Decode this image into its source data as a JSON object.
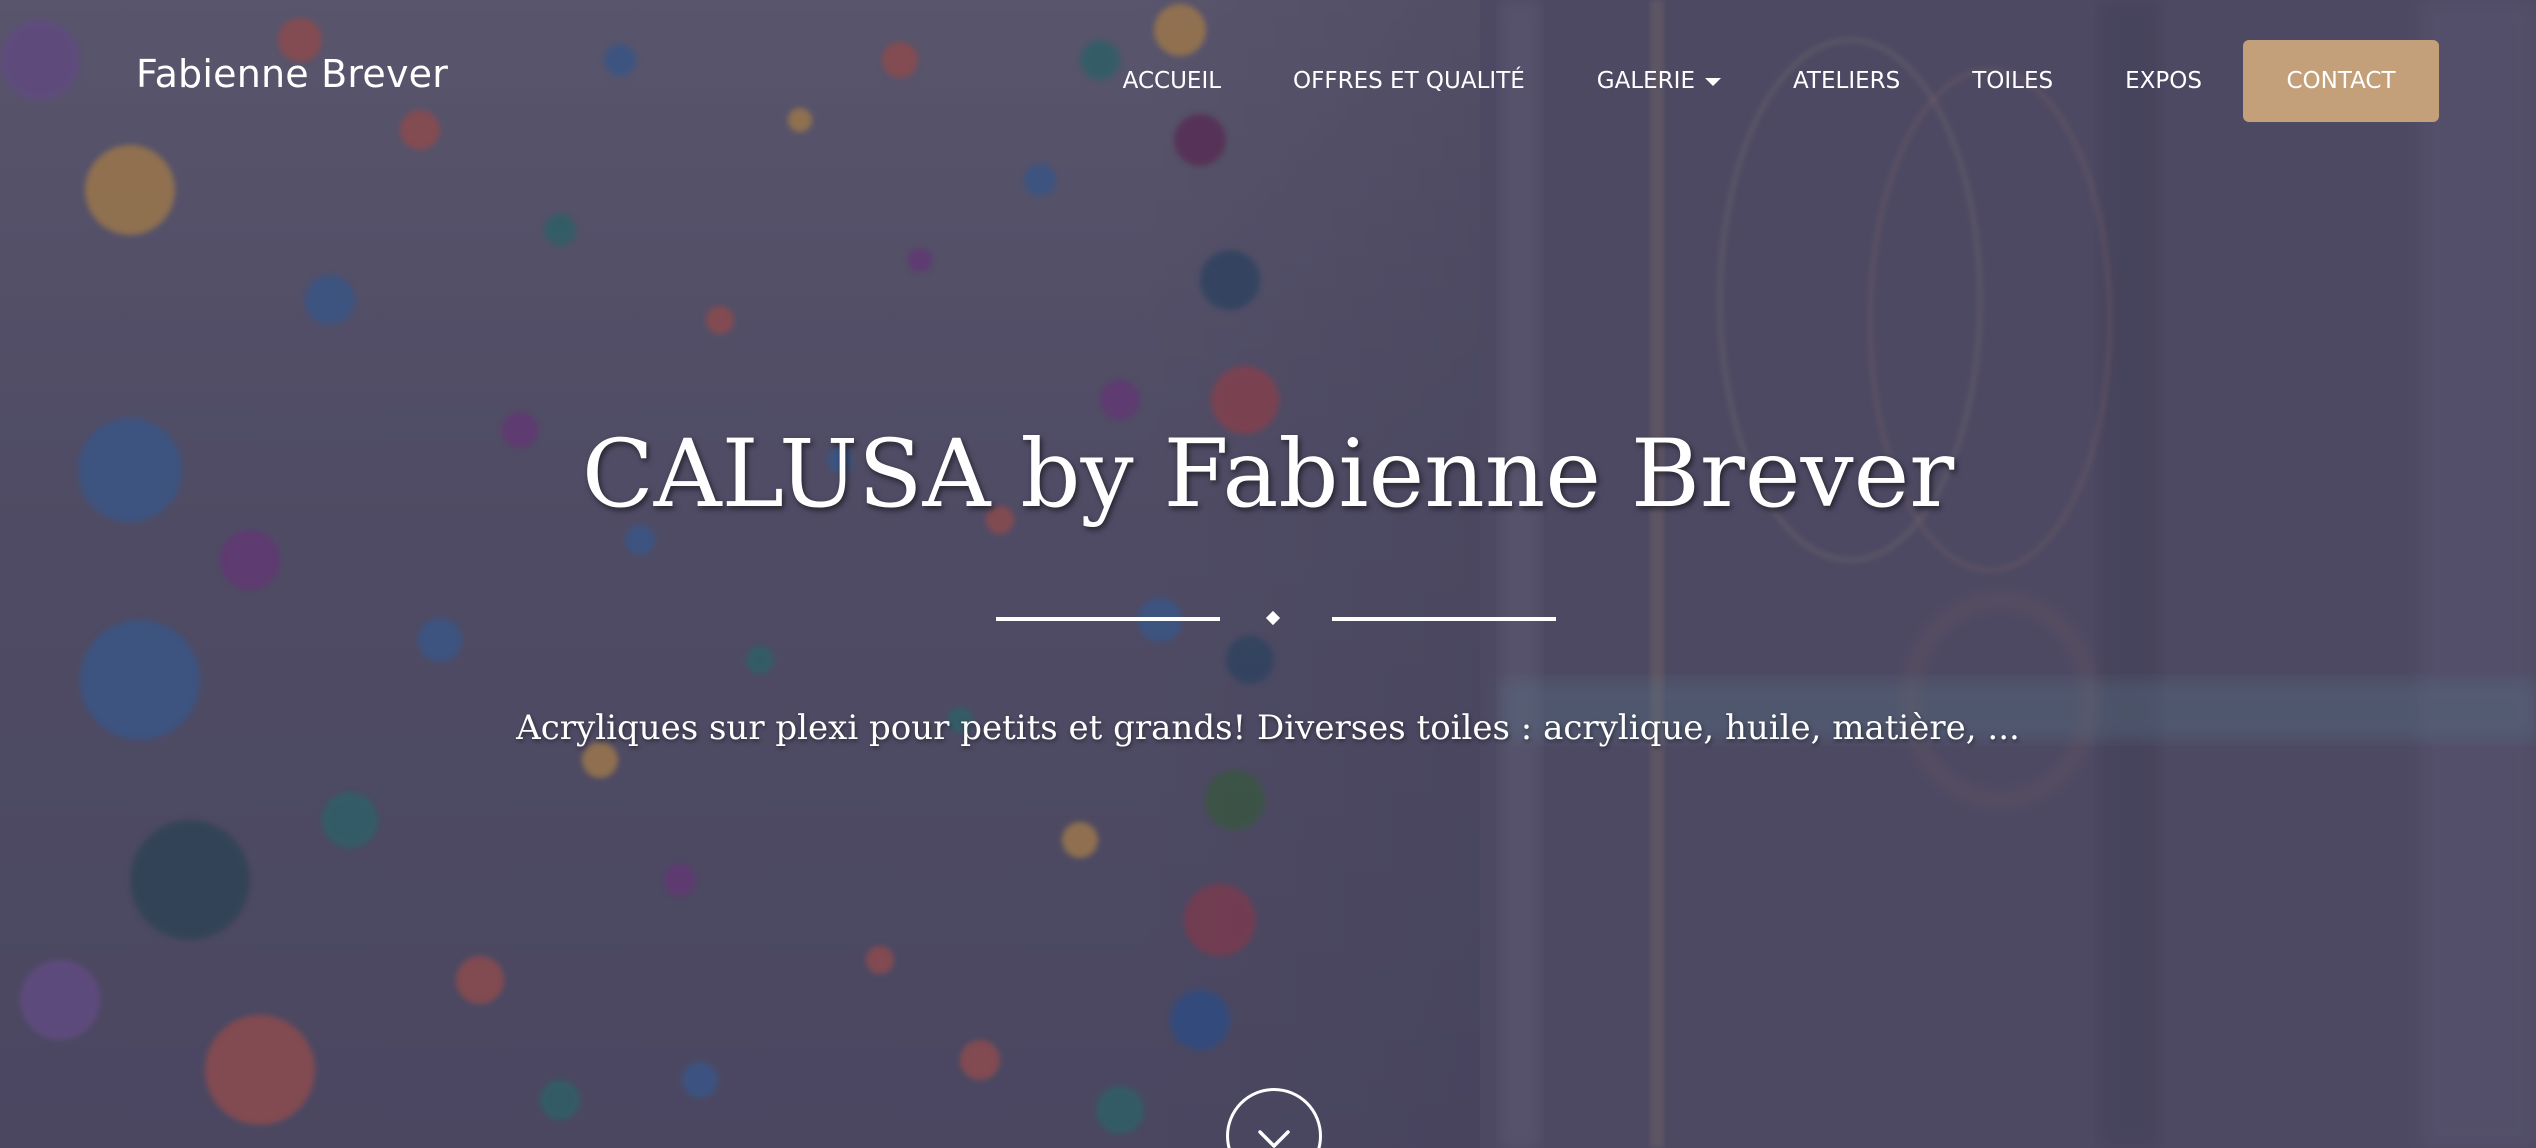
{
  "brand": {
    "name": "Fabienne Brever"
  },
  "nav": {
    "items": [
      {
        "label": "ACCUEIL",
        "icon": null
      },
      {
        "label": "OFFRES ET QUALITÉ",
        "icon": null
      },
      {
        "label": "GALERIE",
        "icon": "caret-down-icon"
      },
      {
        "label": "ATELIERS",
        "icon": null
      },
      {
        "label": "TOILES",
        "icon": null
      },
      {
        "label": "EXPOS",
        "icon": null
      }
    ],
    "contact_label": "CONTACT"
  },
  "hero": {
    "title": "CALUSA by Fabienne Brever",
    "subtitle": "Acryliques sur plexi pour petits et grands! Diverses toiles : acrylique, huile, matière, ...",
    "scroll_icon": "chevron-down-icon"
  },
  "colors": {
    "accent": "#c4a07a",
    "text": "#ffffff",
    "overlay": "#3c3852"
  }
}
